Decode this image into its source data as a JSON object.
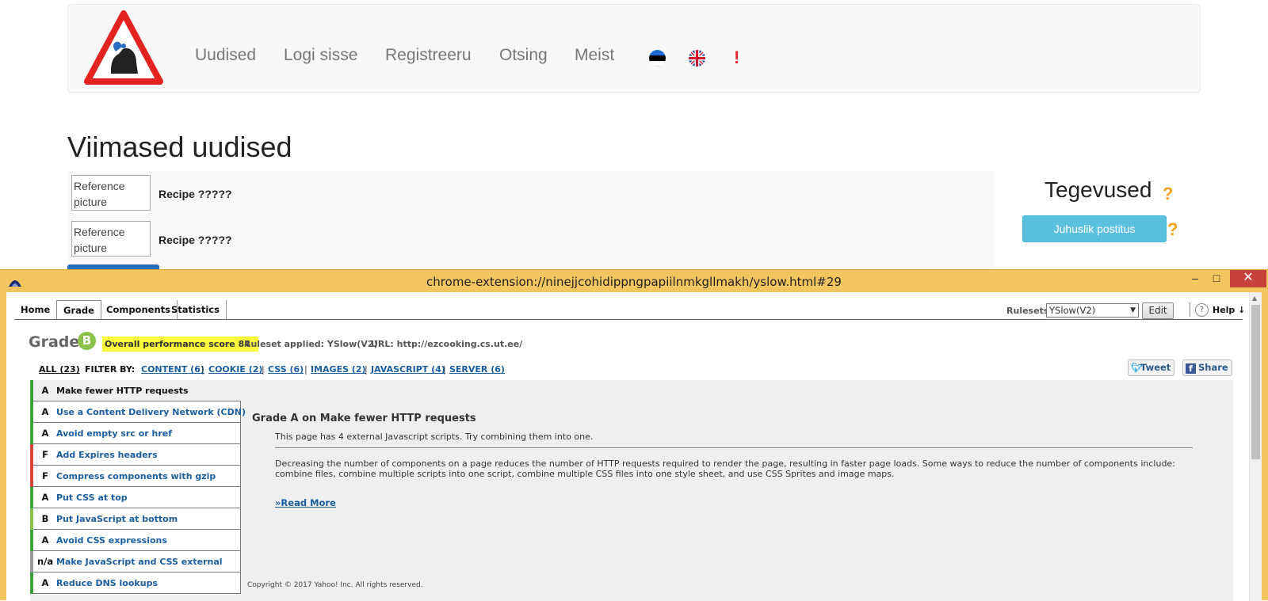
{
  "site": {
    "nav": [
      "Uudised",
      "Logi sisse",
      "Registreeru",
      "Otsing",
      "Meist"
    ],
    "alert_mark": "!",
    "page_title": "Viimased uudised",
    "news": [
      {
        "image_alt": "Reference picture",
        "title": "Recipe ?????"
      },
      {
        "image_alt": "Reference picture",
        "title": "Recipe ?????"
      }
    ],
    "sidebar": {
      "title": "Tegevused",
      "help_mark": "?",
      "random_button": "Juhuslik postitus"
    }
  },
  "window": {
    "title": "chrome-extension://ninejjcohidippngpapiilnmkgllmakh/yslow.html#29",
    "controls": {
      "minimize": "–",
      "maximize": "□",
      "close": "✕"
    }
  },
  "yslow": {
    "tabs": [
      "Home",
      "Grade",
      "Components",
      "Statistics"
    ],
    "active_tab": "Grade",
    "rulesets_label": "Rulesets",
    "ruleset_selected": "YSlow(V2)",
    "edit_label": "Edit",
    "help_icon": "?",
    "help_label": "Help ↓",
    "grade_label": "Grade",
    "grade": "B",
    "score_text": "Overall performance score 84",
    "ruleset_applied": "Ruleset applied: YSlow(V2)",
    "url_text": "URL: http://ezcooking.cs.ut.ee/",
    "filter": {
      "all": "ALL (23)",
      "by": "FILTER BY:",
      "links": [
        "CONTENT (6)",
        "COOKIE (2)",
        "CSS (6)",
        "IMAGES (2)",
        "JAVASCRIPT (4)",
        "SERVER (6)"
      ]
    },
    "share": {
      "tweet": "Tweet",
      "facebook": "Share"
    },
    "rules": [
      {
        "grade": "A",
        "name": "Make fewer HTTP requests"
      },
      {
        "grade": "A",
        "name": "Use a Content Delivery Network (CDN)"
      },
      {
        "grade": "A",
        "name": "Avoid empty src or href"
      },
      {
        "grade": "F",
        "name": "Add Expires headers"
      },
      {
        "grade": "F",
        "name": "Compress components with gzip"
      },
      {
        "grade": "A",
        "name": "Put CSS at top"
      },
      {
        "grade": "B",
        "name": "Put JavaScript at bottom"
      },
      {
        "grade": "A",
        "name": "Avoid CSS expressions"
      },
      {
        "grade": "n/a",
        "name": "Make JavaScript and CSS external"
      },
      {
        "grade": "A",
        "name": "Reduce DNS lookups"
      }
    ],
    "grade_colors": {
      "A": "#3aa03a",
      "B": "#8bc34a",
      "F": "#d9443a",
      "n/a": "#999999"
    },
    "detail": {
      "title": "Grade A on Make fewer HTTP requests",
      "message": "This page has 4 external Javascript scripts. Try combining them into one.",
      "description": "Decreasing the number of components on a page reduces the number of HTTP requests required to render the page, resulting in faster page loads. Some ways to reduce the number of components include: combine files, combine multiple scripts into one script, combine multiple CSS files into one style sheet, and use CSS Sprites and image maps.",
      "read_more": "»Read More"
    },
    "copyright": "Copyright © 2017 Yahoo! Inc. All rights reserved."
  }
}
